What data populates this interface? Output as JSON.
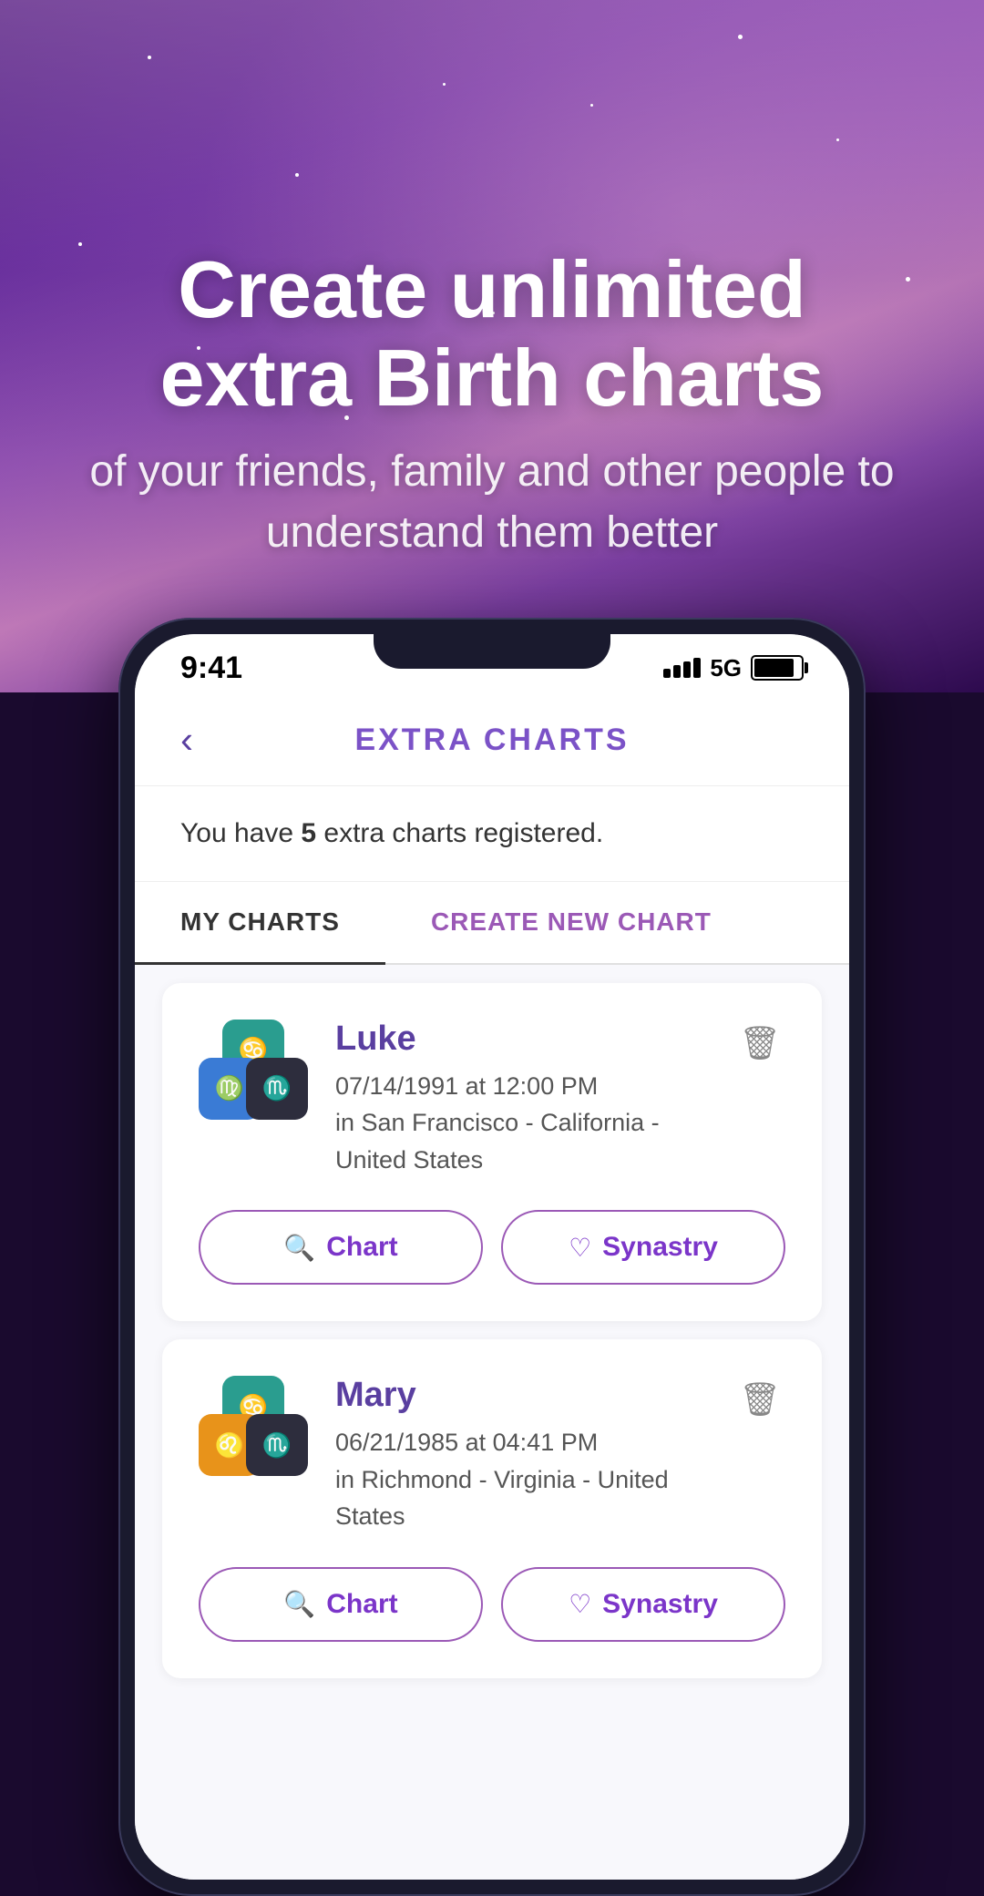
{
  "hero": {
    "title_line1": "Create unlimited",
    "title_line2": "extra Birth charts",
    "subtitle": "of your friends, family and other people to understand them better"
  },
  "status_bar": {
    "time": "9:41",
    "signal": "5G",
    "battery": "85"
  },
  "header": {
    "title": "EXTRA CHARTS",
    "back_label": "‹"
  },
  "info": {
    "text_pre": "You have ",
    "count": "5",
    "text_post": " extra charts registered."
  },
  "tabs": [
    {
      "label": "MY CHARTS",
      "active": true
    },
    {
      "label": "CREATE NEW CHART",
      "active": false
    }
  ],
  "charts": [
    {
      "name": "Luke",
      "date": "07/14/1991 at 12:00 PM",
      "location": "in San Francisco - California - United States",
      "signs": [
        "♋",
        "♍",
        "♏"
      ],
      "sign_colors": [
        "teal",
        "blue",
        "dark"
      ],
      "chart_btn": "Chart",
      "synastry_btn": "Synastry"
    },
    {
      "name": "Mary",
      "date": "06/21/1985 at 04:41 PM",
      "location": "in Richmond - Virginia - United States",
      "signs": [
        "♋",
        "♌",
        "♏"
      ],
      "sign_colors": [
        "teal",
        "orange",
        "dark"
      ],
      "chart_btn": "Chart",
      "synastry_btn": "Synastry"
    }
  ],
  "icons": {
    "search": "🔍",
    "heart": "♡",
    "trash": "🗑",
    "back": "‹"
  },
  "colors": {
    "purple_primary": "#7b35c9",
    "purple_light": "#9b59b6",
    "purple_text": "#5a3fa0",
    "teal": "#2a9d8f",
    "blue": "#3a7bd5",
    "dark": "#2d2d3d",
    "orange": "#e8931a"
  }
}
